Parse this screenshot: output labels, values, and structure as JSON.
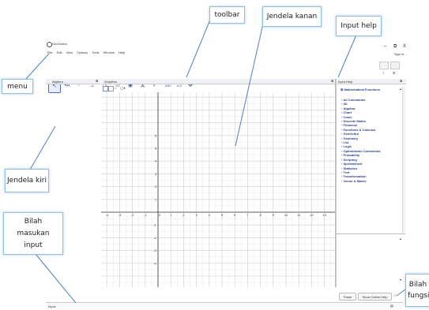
{
  "app": {
    "title": "GeoGebra"
  },
  "menu": [
    "File",
    "Edit",
    "View",
    "Options",
    "Tools",
    "Window",
    "Help"
  ],
  "signin": "Sign in...",
  "window_controls": {
    "minimize": "–",
    "restore": "⧉",
    "close": "X"
  },
  "toolbar_tools": [
    {
      "name": "move-tool",
      "glyph": "↖"
    },
    {
      "name": "point-tool",
      "glyph": "•A"
    },
    {
      "name": "line-tool",
      "glyph": "⟋"
    },
    {
      "name": "perpendicular-tool",
      "glyph": "⊥"
    },
    {
      "name": "polygon-tool",
      "glyph": "▷"
    },
    {
      "name": "circle-tool",
      "glyph": "⊙"
    },
    {
      "name": "ellipse-tool",
      "glyph": "◉"
    },
    {
      "name": "angle-tool",
      "glyph": "∡"
    },
    {
      "name": "reflect-tool",
      "glyph": "⤢"
    },
    {
      "name": "text-tool",
      "glyph": "ABC"
    },
    {
      "name": "slider-tool",
      "glyph": "a=2"
    },
    {
      "name": "move-view-tool",
      "glyph": "✥"
    }
  ],
  "panels": {
    "algebra": "Algebra",
    "graphics": "Graphics",
    "input_help": "Input Help"
  },
  "graph": {
    "x_ticks": [
      "-4",
      "-3",
      "-2",
      "-1",
      "0",
      "1",
      "2",
      "3",
      "4",
      "5",
      "6",
      "7",
      "8",
      "9",
      "10",
      "11",
      "12",
      "13"
    ],
    "y_ticks_pos": [
      "6",
      "5",
      "4",
      "3",
      "2",
      "1"
    ],
    "y_ticks_neg": [
      "-1",
      "-2",
      "-3",
      "-4"
    ]
  },
  "input_help": {
    "math_functions": "Mathematical Functions",
    "categories": [
      "All Commands",
      "3D",
      "Algebra",
      "Chart",
      "Conic",
      "Discrete Maths",
      "Financial",
      "Functions & Calculus",
      "GeoGebra",
      "Geometry",
      "List",
      "Logic",
      "Optimization Commands",
      "Probability",
      "Scripting",
      "Spreadsheet",
      "Statistics",
      "Text",
      "Transformation",
      "Vector & Matrix"
    ],
    "paste_button": "Paste",
    "online_help_button": "Show Online Help"
  },
  "input_bar": {
    "label": "Input:"
  },
  "annotations": {
    "toolbar": "toolbar",
    "jendela_kanan": "Jendela kanan",
    "input_help": "Input help",
    "menu": "menu",
    "jendela_kiri": "Jendela kiri",
    "bilah_masukan": "Bilah masukan input",
    "bilah_fungsi": "Bilah fungsi"
  }
}
